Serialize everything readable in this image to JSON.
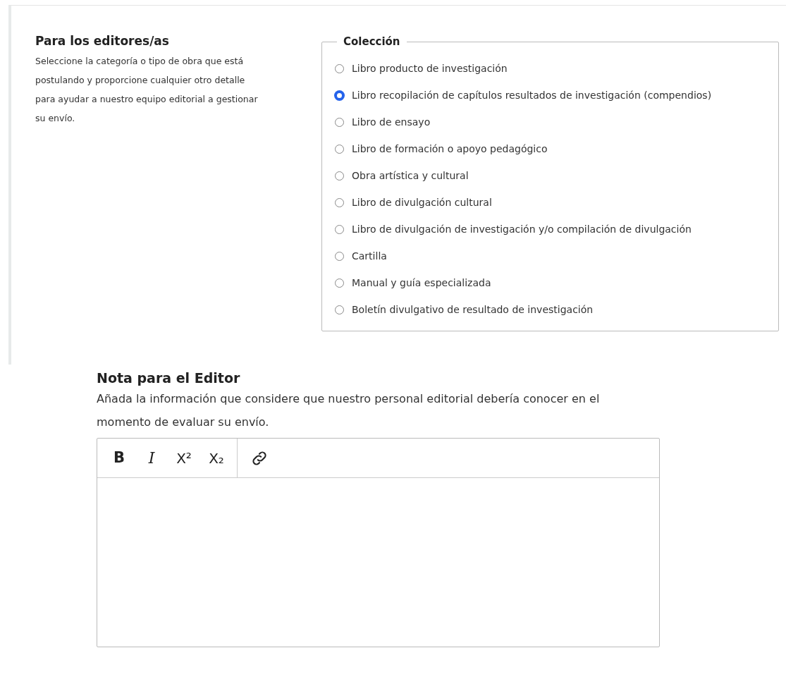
{
  "editors_section": {
    "title": "Para los editores/as",
    "description": "Seleccione la categoría o tipo de obra que está postulando y proporcione cualquier otro detalle para ayudar a nuestro equipo editorial a gestionar su envío."
  },
  "collection": {
    "legend": "Colección",
    "options": [
      {
        "label": "Libro producto de investigación",
        "selected": false
      },
      {
        "label": "Libro recopilación de capítulos resultados de investigación (compendios)",
        "selected": true
      },
      {
        "label": "Libro de ensayo",
        "selected": false
      },
      {
        "label": "Libro de formación o apoyo pedagógico",
        "selected": false
      },
      {
        "label": "Obra artística y cultural",
        "selected": false
      },
      {
        "label": "Libro de divulgación cultural",
        "selected": false
      },
      {
        "label": "Libro de divulgación de investigación y/o compilación de divulgación",
        "selected": false
      },
      {
        "label": "Cartilla",
        "selected": false
      },
      {
        "label": "Manual y guía especializada",
        "selected": false
      },
      {
        "label": "Boletín divulgativo de resultado de investigación",
        "selected": false
      }
    ]
  },
  "editor_note": {
    "title": "Nota para el Editor",
    "description": "Añada la información que considere que nuestro personal editorial debería conocer en el momento de evaluar su envío.",
    "toolbar": [
      {
        "kind": "bold",
        "label": "B"
      },
      {
        "kind": "italic",
        "label": "I"
      },
      {
        "kind": "script",
        "label": "X²"
      },
      {
        "kind": "script",
        "label": "X₂"
      },
      {
        "kind": "link"
      }
    ]
  }
}
